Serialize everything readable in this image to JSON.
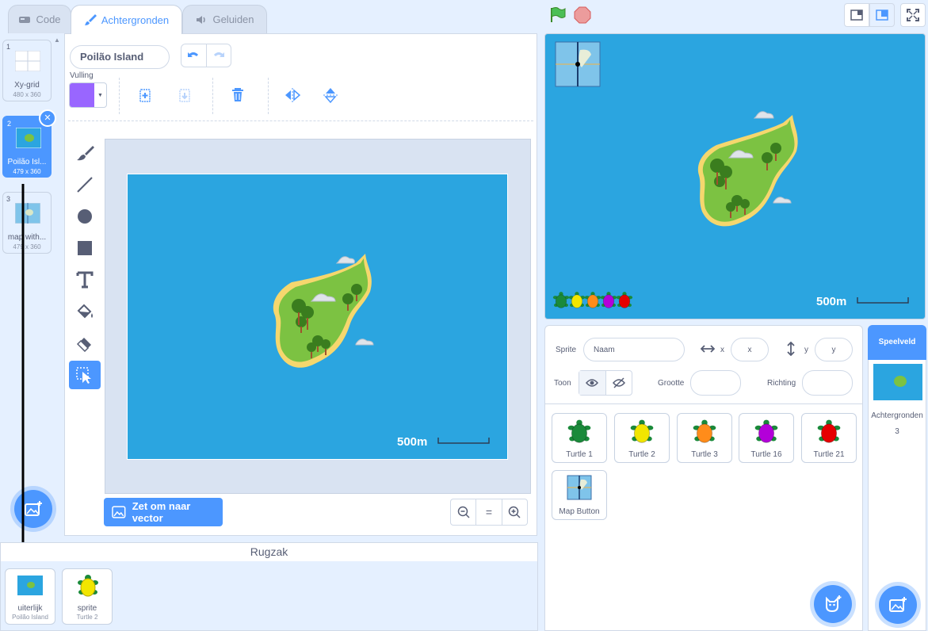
{
  "tabs": [
    {
      "label": "Code"
    },
    {
      "label": "Achtergronden"
    },
    {
      "label": "Geluiden"
    }
  ],
  "costumes": [
    {
      "number": "1",
      "name": "Xy-grid",
      "size": "480 x 360"
    },
    {
      "number": "2",
      "name": "Poilão Isl...",
      "size": "479 x 360"
    },
    {
      "number": "3",
      "name": "map with...",
      "size": "479 x 360"
    }
  ],
  "editor": {
    "costume_name": "Poilão Island",
    "fill_label": "Vulling",
    "fill_color": "#9966ff",
    "convert_button": "Zet om naar vector",
    "scale_label": "500m",
    "zoom_reset": "="
  },
  "backpack": {
    "title": "Rugzak",
    "items": [
      {
        "type": "uiterlijk",
        "name": "Poilão Island"
      },
      {
        "type": "sprite",
        "name": "Turtle 2"
      }
    ]
  },
  "stage": {
    "scale_label": "500m",
    "turtle_colors": [
      "#1a8a3a",
      "#f2e600",
      "#ff8c1a",
      "#b300d9",
      "#e60000"
    ]
  },
  "sprite_info": {
    "sprite_label": "Sprite",
    "name_placeholder": "Naam",
    "x_label": "x",
    "x_placeholder": "x",
    "y_label": "y",
    "y_placeholder": "y",
    "show_label": "Toon",
    "size_label": "Grootte",
    "direction_label": "Richting"
  },
  "sprites": [
    {
      "name": "Turtle 1",
      "color": "#1a8a3a"
    },
    {
      "name": "Turtle 2",
      "color": "#f2e600"
    },
    {
      "name": "Turtle 3",
      "color": "#ff8c1a"
    },
    {
      "name": "Turtle 16",
      "color": "#b300d9"
    },
    {
      "name": "Turtle 21",
      "color": "#e60000"
    },
    {
      "name": "Map Button",
      "color": ""
    }
  ],
  "stage_panel": {
    "title": "Speelveld",
    "backdrops_label": "Achtergronden",
    "backdrops_count": "3"
  },
  "colors": {
    "accent": "#4c97ff",
    "sea": "#2ba5e0",
    "island_green": "#7cc242",
    "sand": "#f5d76e"
  }
}
